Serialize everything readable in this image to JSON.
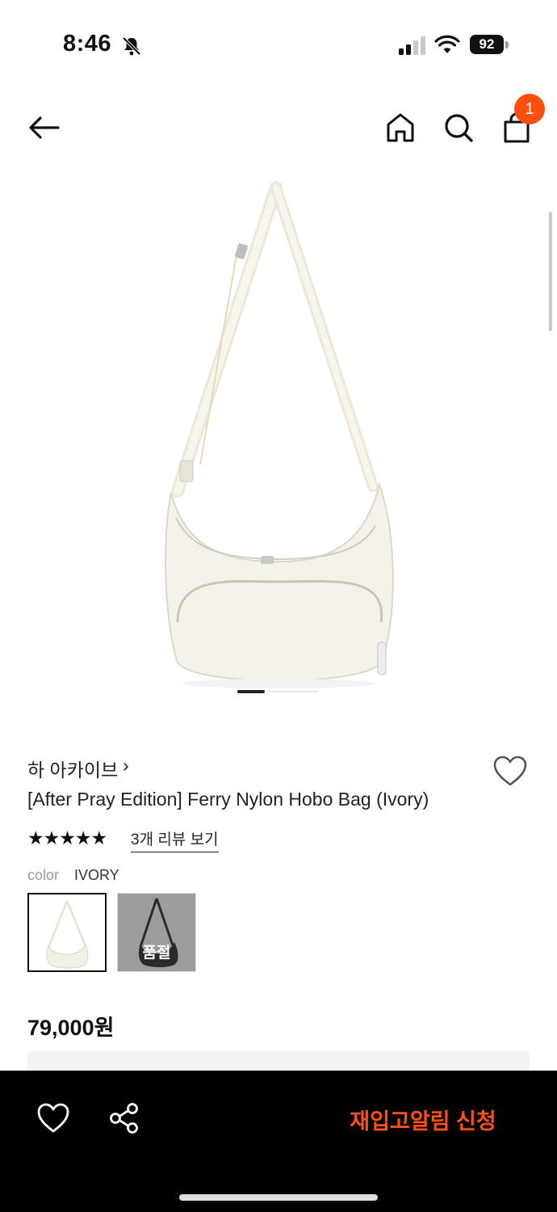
{
  "status_bar": {
    "time": "8:46",
    "battery": "92",
    "icons": [
      "bell-slash-icon",
      "signal-icon",
      "wifi-icon",
      "battery-icon"
    ]
  },
  "header": {
    "cart_count": "1",
    "icons": [
      "back-arrow-icon",
      "home-icon",
      "search-icon",
      "shopping-bag-icon"
    ]
  },
  "gallery": {
    "active_index": 0
  },
  "product": {
    "brand": "하 아카이브",
    "brand_chevron": "›",
    "title": "[After Pray Edition] Ferry Nylon Hobo Bag (Ivory)",
    "rating_stars": "★★★★★",
    "rating": 5,
    "review_link": "3개 리뷰 보기",
    "color_label": "color",
    "color_value": "IVORY",
    "swatches": [
      {
        "name": "ivory",
        "selected": true
      },
      {
        "name": "black",
        "sold_out_label": "품절"
      }
    ],
    "price": "79,000원"
  },
  "bottom_bar": {
    "cta_label": "재입고알림 신청",
    "cta_color": "#ff4f12",
    "icons": [
      "heart-icon",
      "share-icon"
    ]
  },
  "colors": {
    "accent": "#ff4e0e",
    "bottom_bar_bg": "#000000"
  }
}
